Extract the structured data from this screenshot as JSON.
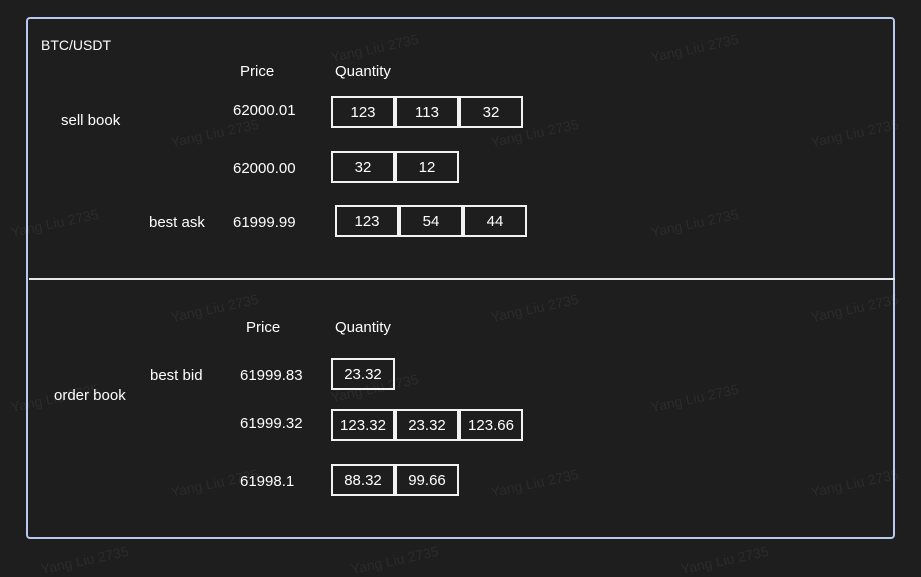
{
  "pair": "BTC/USDT",
  "watermark_text": "Yang Liu 2735",
  "sell_book": {
    "section_label": "sell book",
    "price_header": "Price",
    "quantity_header": "Quantity",
    "best_label": "best ask",
    "levels": [
      {
        "price": "62000.01",
        "quantities": [
          "123",
          "113",
          "32"
        ]
      },
      {
        "price": "62000.00",
        "quantities": [
          "32",
          "12"
        ]
      },
      {
        "price": "61999.99",
        "quantities": [
          "123",
          "54",
          "44"
        ]
      }
    ]
  },
  "order_book": {
    "section_label": "order book",
    "price_header": "Price",
    "quantity_header": "Quantity",
    "best_label": "best bid",
    "levels": [
      {
        "price": "61999.83",
        "quantities": [
          "23.32"
        ]
      },
      {
        "price": "61999.32",
        "quantities": [
          "123.32",
          "23.32",
          "123.66"
        ]
      },
      {
        "price": "61998.1",
        "quantities": [
          "88.32",
          "99.66"
        ]
      }
    ]
  },
  "colors": {
    "background": "#1e1e1e",
    "panel_border": "#b8c8ee",
    "text": "#ffffff"
  }
}
